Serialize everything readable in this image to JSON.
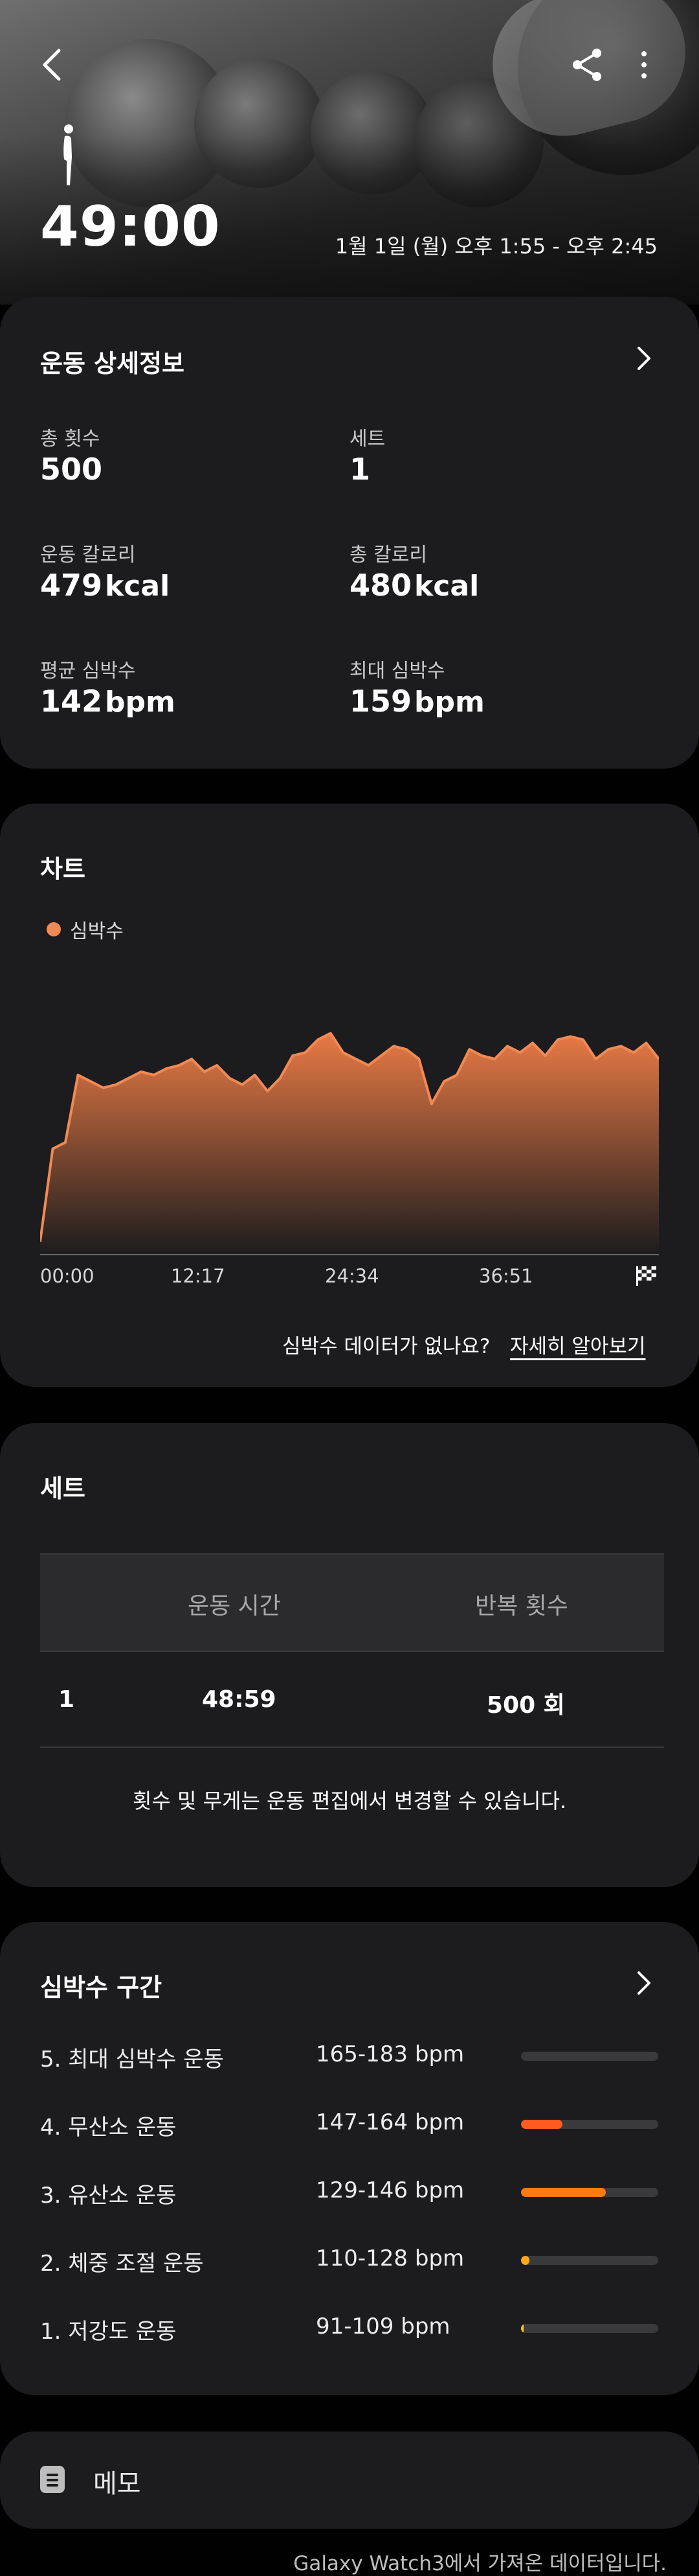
{
  "header": {
    "duration": "49:00",
    "datetime": "1월 1일 (월) 오후 1:55 - 오후 2:45",
    "back_icon": "chevron-left-icon",
    "share_icon": "share-icon",
    "more_icon": "more-vertical-icon",
    "activity_icon": "standing-person-icon"
  },
  "details": {
    "title": "운동 상세정보",
    "stats": [
      {
        "label": "총 횟수",
        "value": "500",
        "unit": ""
      },
      {
        "label": "세트",
        "value": "1",
        "unit": ""
      },
      {
        "label": "운동 칼로리",
        "value": "479",
        "unit": "kcal"
      },
      {
        "label": "총 칼로리",
        "value": "480",
        "unit": "kcal"
      },
      {
        "label": "평균 심박수",
        "value": "142",
        "unit": "bpm"
      },
      {
        "label": "최대 심박수",
        "value": "159",
        "unit": "bpm"
      }
    ]
  },
  "chart": {
    "title": "차트",
    "legend": "심박수",
    "no_data_question": "심박수 데이터가 없나요?",
    "learn_more": "자세히 알아보기"
  },
  "chart_data": {
    "type": "area",
    "title": "차트",
    "series": [
      {
        "name": "심박수"
      }
    ],
    "x_tick_labels": [
      "00:00",
      "12:17",
      "24:34",
      "36:51"
    ],
    "x_minutes": [
      0,
      1,
      2,
      3,
      4,
      5,
      6,
      7,
      8,
      9,
      10,
      11,
      12,
      13,
      14,
      15,
      16,
      17,
      18,
      19,
      20,
      21,
      22,
      23,
      24,
      25,
      26,
      27,
      28,
      29,
      30,
      31,
      32,
      33,
      34,
      35,
      36,
      37,
      38,
      39,
      40,
      41,
      42,
      43,
      44,
      45,
      46,
      47,
      48,
      49
    ],
    "y_bpm": [
      89,
      118,
      120,
      141,
      139,
      137,
      138,
      140,
      142,
      141,
      143,
      144,
      146,
      142,
      144,
      140,
      138,
      141,
      136,
      140,
      147,
      148,
      152,
      154,
      148,
      146,
      144,
      147,
      150,
      149,
      146,
      132,
      139,
      141,
      149,
      147,
      146,
      150,
      148,
      151,
      147,
      152,
      153,
      152,
      146,
      149,
      150,
      148,
      151,
      146
    ],
    "y_range_bpm": [
      85,
      165
    ],
    "colors": {
      "line": "#f08a55",
      "fill_top": "#e97a45",
      "fill_bottom": "#1c1c1e"
    }
  },
  "sets": {
    "title": "세트",
    "columns": [
      "운동 시간",
      "반복 횟수"
    ],
    "rows": [
      {
        "index": "1",
        "time": "48:59",
        "reps": "500 회"
      }
    ],
    "note": "횟수 및 무게는 운동 편집에서 변경할 수 있습니다."
  },
  "zones": {
    "title": "심박수 구간",
    "items": [
      {
        "name": "5. 최대 심박수 운동",
        "range": "165-183 bpm",
        "fraction": 0.0,
        "color": "#ff5a1f"
      },
      {
        "name": "4. 무산소 운동",
        "range": "147-164 bpm",
        "fraction": 0.3,
        "color": "#ff5a1f"
      },
      {
        "name": "3. 유산소 운동",
        "range": "129-146 bpm",
        "fraction": 0.62,
        "color": "#ff7a10"
      },
      {
        "name": "2. 체중 조절 운동",
        "range": "110-128 bpm",
        "fraction": 0.06,
        "color": "#ffa81a"
      },
      {
        "name": "1. 저강도 운동",
        "range": "91-109 bpm",
        "fraction": 0.02,
        "color": "#ffc21a"
      }
    ]
  },
  "memo": {
    "label": "메모",
    "icon": "note-icon"
  },
  "footer": {
    "source": "Galaxy Watch3에서 가져온 데이터입니다."
  }
}
